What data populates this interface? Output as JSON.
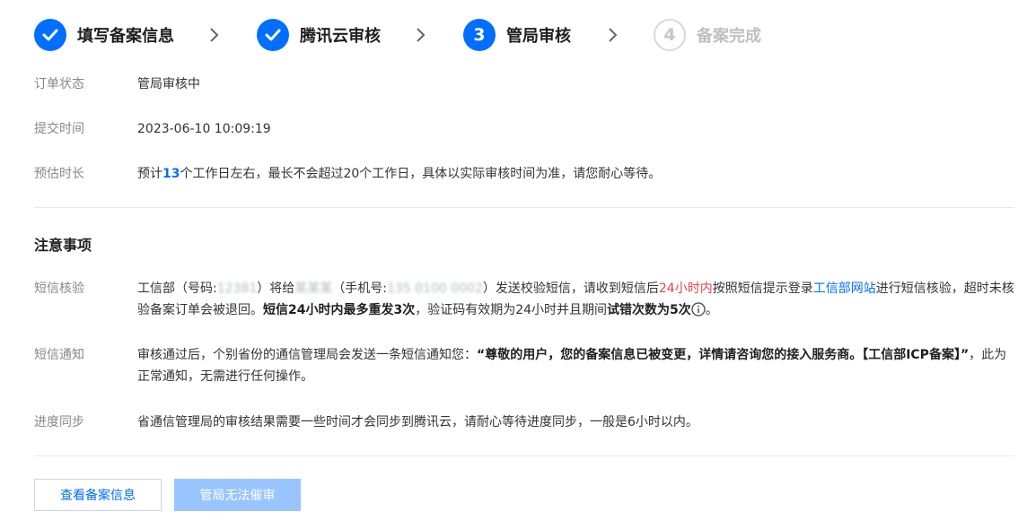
{
  "steps": [
    {
      "label": "填写备案信息",
      "state": "done"
    },
    {
      "label": "腾讯云审核",
      "state": "done"
    },
    {
      "label": "管局审核",
      "state": "active",
      "number": "3"
    },
    {
      "label": "备案完成",
      "state": "pending",
      "number": "4"
    }
  ],
  "order": {
    "status_label": "订单状态",
    "status_value": "管局审核中",
    "submit_label": "提交时间",
    "submit_value": "2023-06-10 10:09:19",
    "estimate_label": "预估时长",
    "estimate_prefix": "预计",
    "estimate_days": "13",
    "estimate_suffix": "个工作日左右，最长不会超过20个工作日，具体以实际审核时间为准，请您耐心等待。"
  },
  "notes": {
    "title": "注意事项",
    "sms_verify": {
      "label": "短信核验",
      "t1": "工信部（号码:",
      "masked_code": "12381",
      "t2": "）将给",
      "masked_name": "某某某",
      "t3": "（手机号:",
      "masked_phone": "135 0100 0002",
      "t4": "）发送校验短信，请收到短信后",
      "deadline": "24小时内",
      "t5": "按照短信提示登录",
      "link": "工信部网站",
      "t6": "进行短信核验，超时未核验备案订单会被退回。",
      "bold1": "短信24小时内最多重发3次",
      "t7": "，验证码有效期为24小时并且期间",
      "bold2": "试错次数为5次",
      "t8": "。"
    },
    "sms_notice": {
      "label": "短信通知",
      "t1": "审核通过后，个别省份的通信管理局会发送一条短信通知您：",
      "bold": "“尊敬的用户，您的备案信息已被变更，详情请咨询您的接入服务商。【工信部ICP备案】”",
      "t2": "，此为正常通知，无需进行任何操作。"
    },
    "progress_sync": {
      "label": "进度同步",
      "text": "省通信管理局的审核结果需要一些时间才会同步到腾讯云，请耐心等待进度同步，一般是6小时以内。"
    }
  },
  "buttons": {
    "view_label": "查看备案信息",
    "urge_label": "管局无法催审"
  },
  "colors": {
    "primary": "#006eff",
    "deadline_red": "#e54545",
    "disabled_button": "#99c5ff"
  }
}
